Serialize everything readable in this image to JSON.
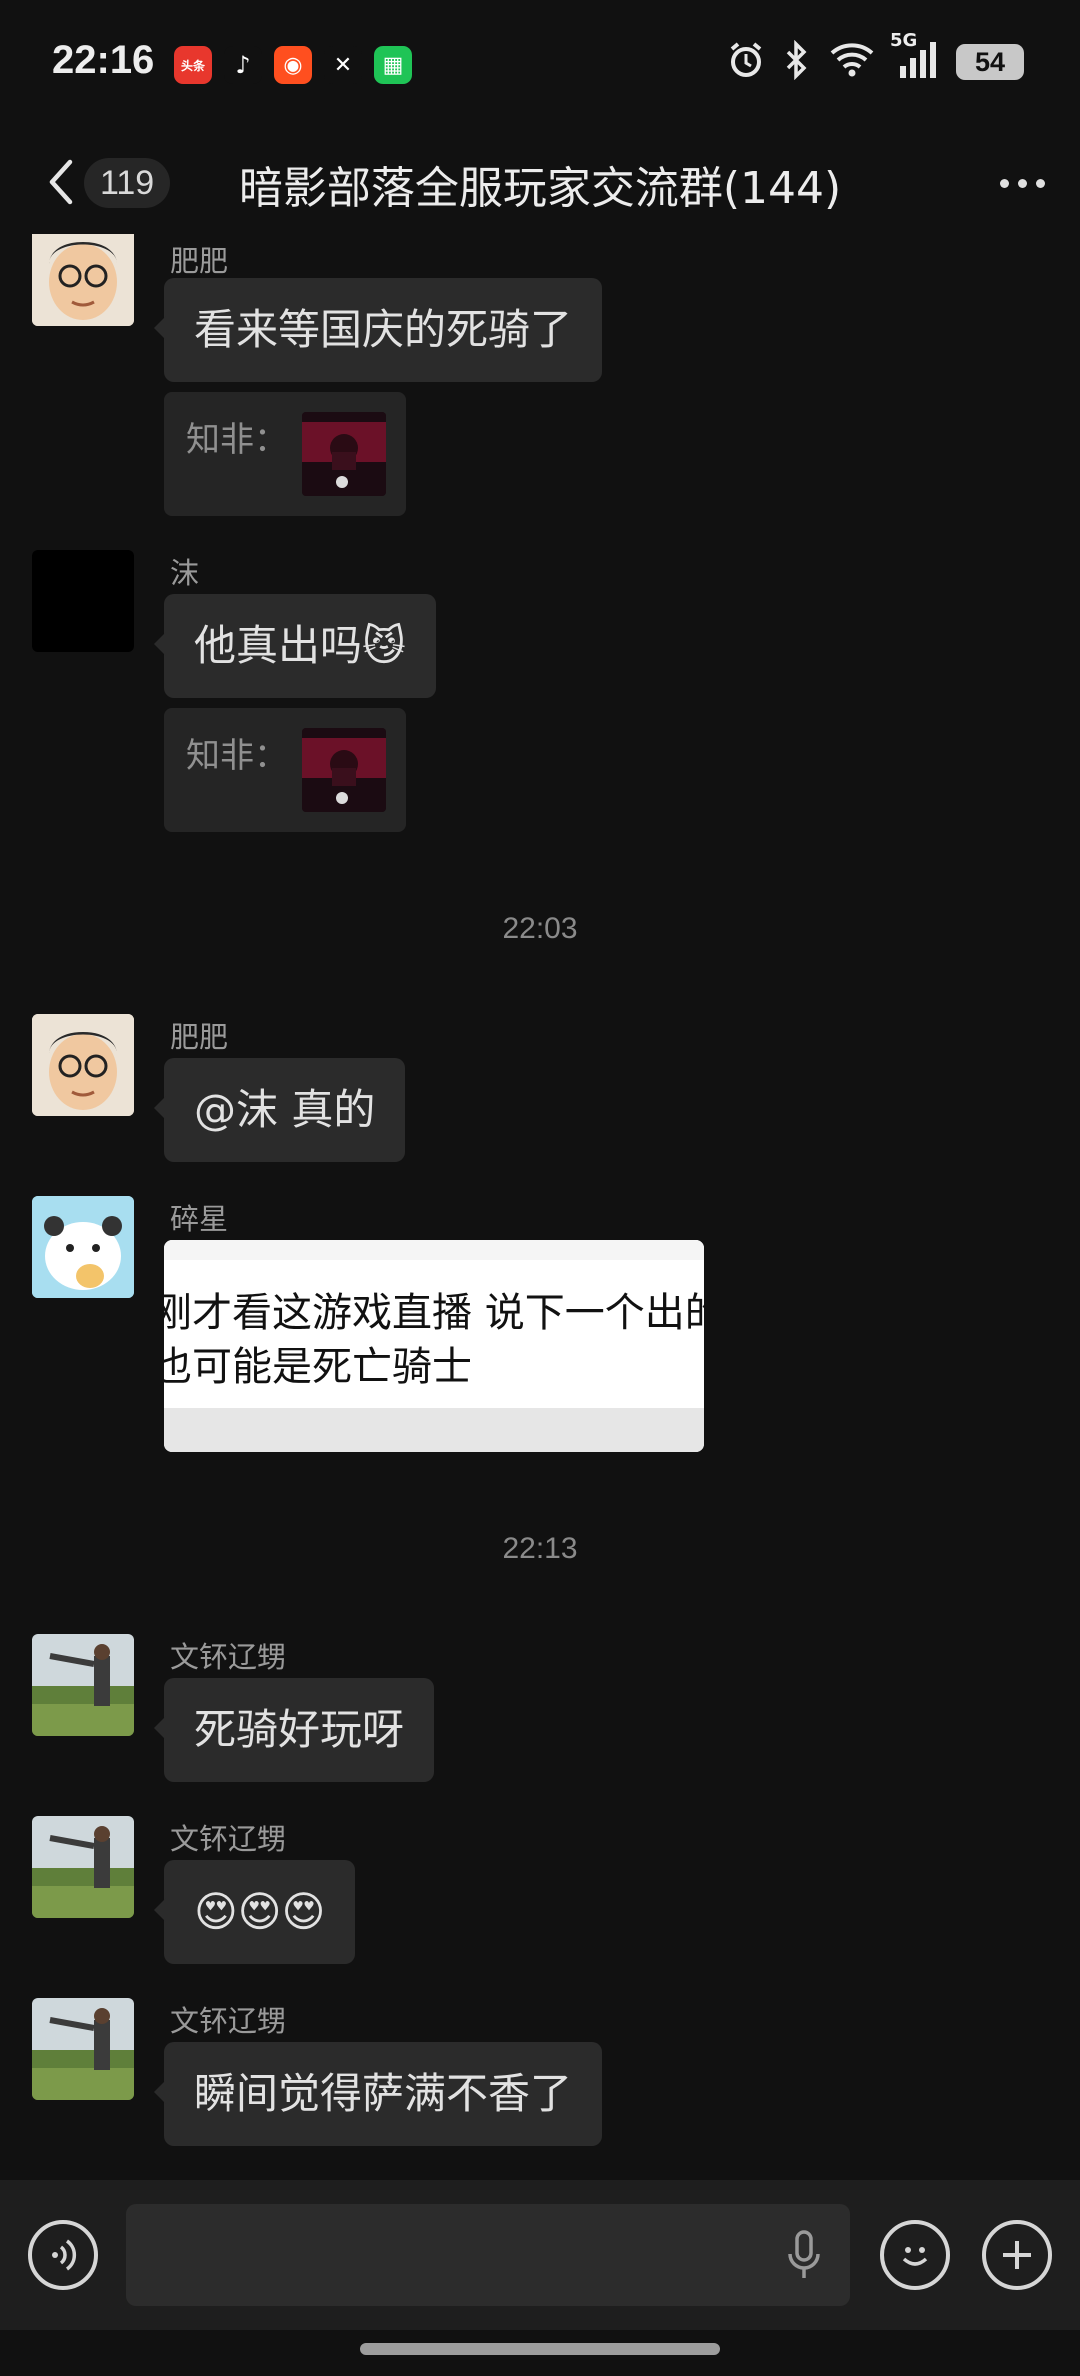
{
  "status_bar": {
    "time": "22:16",
    "app_icons": [
      {
        "icon": "toutiao-icon",
        "label": "头条",
        "color": "#e8372d"
      },
      {
        "icon": "douyin-icon",
        "label": "♪",
        "color": "#111111"
      },
      {
        "icon": "kuaishou-icon",
        "label": "◉",
        "color": "#ff4f1f"
      },
      {
        "icon": "capcut-icon",
        "label": "✕",
        "color": "#111111"
      },
      {
        "icon": "green-app-icon",
        "label": "▦",
        "color": "#1fc456"
      }
    ],
    "network": "5G",
    "battery": "54"
  },
  "header": {
    "unread_count": "119",
    "title": "暗影部落全服玩家交流群(144)"
  },
  "messages": [
    {
      "sender": "肥肥",
      "text": "看来等国庆的死骑了",
      "quote_name": "知非："
    },
    {
      "sender": "沫",
      "text": "他真出吗😼",
      "quote_name": "知非："
    },
    {
      "timestamp": "22:03"
    },
    {
      "sender": "肥肥",
      "text": "@沫  真的"
    },
    {
      "sender": "碎星",
      "image_lines": [
        "刚才看这游戏直播 说下一个出的",
        "也可能是死亡骑士"
      ]
    },
    {
      "timestamp": "22:13"
    },
    {
      "sender": "文钚辽甥",
      "text": "死骑好玩呀"
    },
    {
      "sender": "文钚辽甥",
      "text": "😍😍😍"
    },
    {
      "sender": "文钚辽甥",
      "text": "瞬间觉得萨满不香了"
    }
  ],
  "input": {
    "placeholder": ""
  }
}
